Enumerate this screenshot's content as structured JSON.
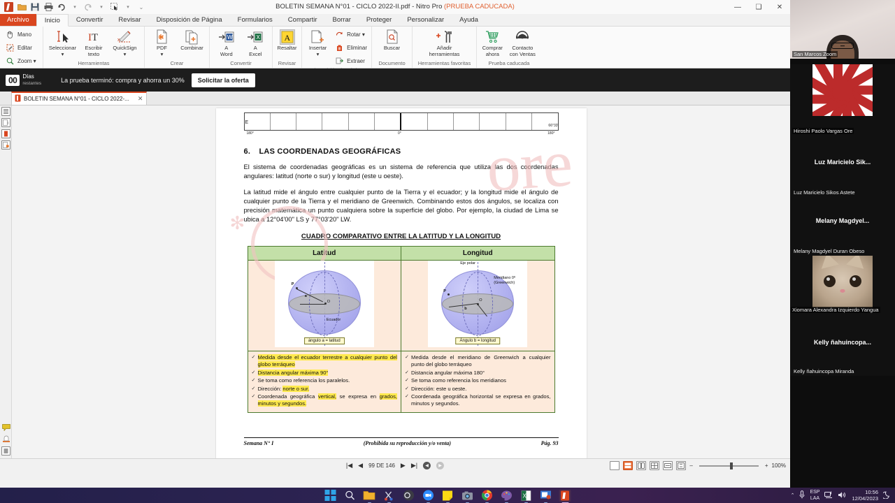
{
  "window": {
    "title_main": "BOLETIN SEMANA N°01 - CICLO 2022-II.pdf - Nitro Pro ",
    "title_expired": "(PRUEBA CADUCADA)",
    "minimize": "—",
    "maximize": "❑",
    "close": "✕"
  },
  "quick_access": {
    "open_icon": "folder-open-icon",
    "save_icon": "save-icon",
    "print_icon": "print-icon",
    "undo_icon": "undo-icon",
    "redo_icon": "redo-icon",
    "select_icon": "select-icon",
    "customize_icon": "customize-icon"
  },
  "menu": {
    "file": "Archivo",
    "tabs": [
      "Inicio",
      "Convertir",
      "Revisar",
      "Disposición de Página",
      "Formularios",
      "Compartir",
      "Borrar",
      "Proteger",
      "Personalizar",
      "Ayuda"
    ]
  },
  "ribbon": {
    "groups": [
      {
        "label": "",
        "small_items": [
          {
            "icon": "hand-icon",
            "label": "Mano"
          },
          {
            "icon": "edit-icon",
            "label": "Editar"
          },
          {
            "icon": "zoom-icon",
            "label": "Zoom ▾"
          }
        ]
      },
      {
        "label": "Herramientas",
        "items": [
          {
            "icon": "cursor-select-icon",
            "label": "Seleccionar\n▾"
          },
          {
            "icon": "type-text-icon",
            "label": "Escribir\ntexto"
          },
          {
            "icon": "quicksign-icon",
            "label": "QuickSign\n▾"
          }
        ]
      },
      {
        "label": "Crear",
        "items": [
          {
            "icon": "pdf-create-icon",
            "label": "PDF\n▾"
          },
          {
            "icon": "combine-icon",
            "label": "Combinar"
          }
        ]
      },
      {
        "label": "Convertir",
        "items": [
          {
            "icon": "to-word-icon",
            "label": "A\nWord"
          },
          {
            "icon": "to-excel-icon",
            "label": "A\nExcel"
          }
        ]
      },
      {
        "label": "Revisar",
        "items": [
          {
            "icon": "highlight-icon",
            "label": "Resaltar"
          }
        ]
      },
      {
        "label": "Disposición de Página",
        "items": [
          {
            "icon": "insert-page-icon",
            "label": "Insertar\n▾"
          }
        ],
        "small_items": [
          {
            "icon": "rotate-icon",
            "label": "Rotar ▾"
          },
          {
            "icon": "delete-icon",
            "label": "Eliminar"
          },
          {
            "icon": "extract-icon",
            "label": "Extraer"
          }
        ]
      },
      {
        "label": "Documento",
        "items": [
          {
            "icon": "search-doc-icon",
            "label": "Buscar"
          }
        ]
      },
      {
        "label": "Herramientas favoritas",
        "items": [
          {
            "icon": "add-tools-icon",
            "label": "Añadir\nherramientas"
          }
        ]
      },
      {
        "label": "Prueba caducada",
        "items": [
          {
            "icon": "cart-icon",
            "label": "Comprar\nahora"
          },
          {
            "icon": "support-agent-icon",
            "label": "Contacto\ncon Ventas"
          }
        ]
      }
    ]
  },
  "trial": {
    "days_number": "00",
    "days_label": "Días",
    "days_sub": "restantes",
    "message": "La prueba terminó: compra y ahorra un 30%",
    "cta": "Solicitar la oferta"
  },
  "doc_tab": {
    "title": "BOLETIN SEMANA N°01 - CICLO 2022-...",
    "close": "✕"
  },
  "left_rail": {
    "items": [
      "pages-panel-icon",
      "bookmarks-panel-icon",
      "attachments-panel-icon",
      "security-panel-icon"
    ],
    "bottom_items": [
      "comments-icon",
      "stamp-icon",
      "thumbnail-icon"
    ]
  },
  "document": {
    "top_chart": {
      "left_label": "E",
      "left_deg": "180°",
      "center_deg": "0°",
      "right_deg_top": "66°33'",
      "right_deg": "180°"
    },
    "section_number": "6.",
    "section_title": "LAS COORDENADAS GEOGRÁFICAS",
    "paragraph_1": "El sistema de coordenadas geográficas es un sistema de referencia que utiliza las dos coordenadas angulares: latitud (norte o sur) y longitud (este u oeste).",
    "paragraph_2": "La latitud mide el ángulo entre cualquier punto de la Tierra y el ecuador; y la longitud mide el ángulo de cualquier punto de la Tierra y el meridiano de Greenwich. Combinando estos dos ángulos, se localiza con precisión matemática un punto cualquiera sobre la superficie del globo. Por ejemplo, la ciudad de Lima se ubica a 12°04'00\" LS y 77°03'20\" LW.",
    "table_title": "CUADRO COMPARATIVO ENTRE LA LATITUD Y LA LONGITUD",
    "table": {
      "headers": [
        "Latitud",
        "Longitud"
      ],
      "diagram_left": {
        "caption": "ángulo a = latitud",
        "label_equator": "Ecuador",
        "label_p": "P",
        "label_o": "O",
        "label_angle": "a"
      },
      "diagram_right": {
        "caption": "Ángulo b = longitud",
        "label_axis": "Eje polar",
        "label_meridian": "Meridiano 0º",
        "label_greenwich": "(Greenwich)",
        "label_p": "P",
        "label_o": "O",
        "label_angle": "b"
      },
      "left_bullets": [
        [
          {
            "t": "Medida desde el ecuador terrestre a cualquier punto del globo terráqueo",
            "h": true
          }
        ],
        [
          {
            "t": "Distancia angular máxima 90°",
            "h": true
          }
        ],
        [
          {
            "t": "Se toma como referencia los paralelos.",
            "h": false
          }
        ],
        [
          {
            "t": "Dirección: ",
            "h": false
          },
          {
            "t": "norte o sur.",
            "h": true
          }
        ],
        [
          {
            "t": "Coordenada geográfica ",
            "h": false
          },
          {
            "t": "vertical,",
            "h": true
          },
          {
            "t": " se expresa en ",
            "h": false
          },
          {
            "t": "grados, minutos y segundos.",
            "h": true
          }
        ]
      ],
      "right_bullets": [
        [
          {
            "t": "Medida desde el meridiano de Greenwich a cualquier punto del globo terráqueo",
            "h": false
          }
        ],
        [
          {
            "t": "Distancia angular máxima 180°",
            "h": false
          }
        ],
        [
          {
            "t": "Se toma como referencia los meridianos",
            "h": false
          }
        ],
        [
          {
            "t": "Dirección: este u oeste.",
            "h": false
          }
        ],
        [
          {
            "t": "Coordenada geográfica horizontal se expresa en grados, minutos y segundos.",
            "h": false
          }
        ]
      ]
    },
    "footer_left": "Semana N° I",
    "footer_center": "(Prohibida su reproducción y/o venta)",
    "footer_right": "Pág. 93",
    "watermark": "ore"
  },
  "statusbar": {
    "first_page_icon": "first-page-icon",
    "prev_page_icon": "prev-page-icon",
    "page_indicator": "99 DE 146",
    "next_page_icon": "next-page-icon",
    "last_page_icon": "last-page-icon",
    "prev_view_icon": "previous-view-icon",
    "next_view_icon": "next-view-icon",
    "view_modes": [
      "single-page-view-icon",
      "continuous-view-icon",
      "two-page-view-icon",
      "two-page-continuous-view-icon",
      "fit-width-icon",
      "fit-page-icon"
    ],
    "zoom_out": "–",
    "zoom_in": "+",
    "zoom_level": "100%"
  },
  "zoom_meeting": {
    "participants": [
      {
        "name": "San Marcos Zoom",
        "type": "video",
        "display": "bottom-left"
      },
      {
        "name": "Hiroshi Paolo Vargas Ore",
        "type": "image",
        "display": "bottom-left"
      },
      {
        "name": "Luz Maricielo Sik...",
        "name_full": "Luz Maricielo Sikos Astete",
        "type": "name-only",
        "display": "centered"
      },
      {
        "name": "Melany  Magdyel...",
        "name_full": "Melany Magdyel Duran Obeso",
        "type": "name-only",
        "display": "centered"
      },
      {
        "name": "Xiomara Alexandra Izquierdo Yangua",
        "type": "image",
        "display": "bottom-left"
      },
      {
        "name": "Kelly  ñahuincopa...",
        "name_full": "Kelly ñahuincopa Miranda",
        "type": "name-only",
        "display": "centered"
      }
    ]
  },
  "taskbar": {
    "items": [
      {
        "name": "start-button",
        "icon": "windows-logo-icon"
      },
      {
        "name": "search-button",
        "icon": "search-icon"
      },
      {
        "name": "file-explorer",
        "icon": "folder-icon"
      },
      {
        "name": "snipping-tool",
        "icon": "scissors-icon"
      },
      {
        "name": "obs-studio",
        "icon": "obs-icon"
      },
      {
        "name": "zoom-app",
        "icon": "zoom-icon"
      },
      {
        "name": "sticky-notes",
        "icon": "note-icon"
      },
      {
        "name": "camera-app",
        "icon": "camera-icon"
      },
      {
        "name": "google-chrome",
        "icon": "chrome-icon"
      },
      {
        "name": "paint-app",
        "icon": "paint-icon"
      },
      {
        "name": "excel-app",
        "icon": "excel-icon"
      },
      {
        "name": "powerpoint-app",
        "icon": "powerpoint-icon"
      },
      {
        "name": "nitro-pro-app",
        "icon": "nitro-icon"
      }
    ],
    "tray": {
      "chevron": "⌃",
      "mic_icon": "microphone-icon",
      "language": "ESP",
      "keyboard": "LAA",
      "network_icon": "network-icon",
      "volume_icon": "volume-icon",
      "time": "10:56",
      "date": "12/04/2023",
      "notification_icon": "moon-icon"
    }
  }
}
